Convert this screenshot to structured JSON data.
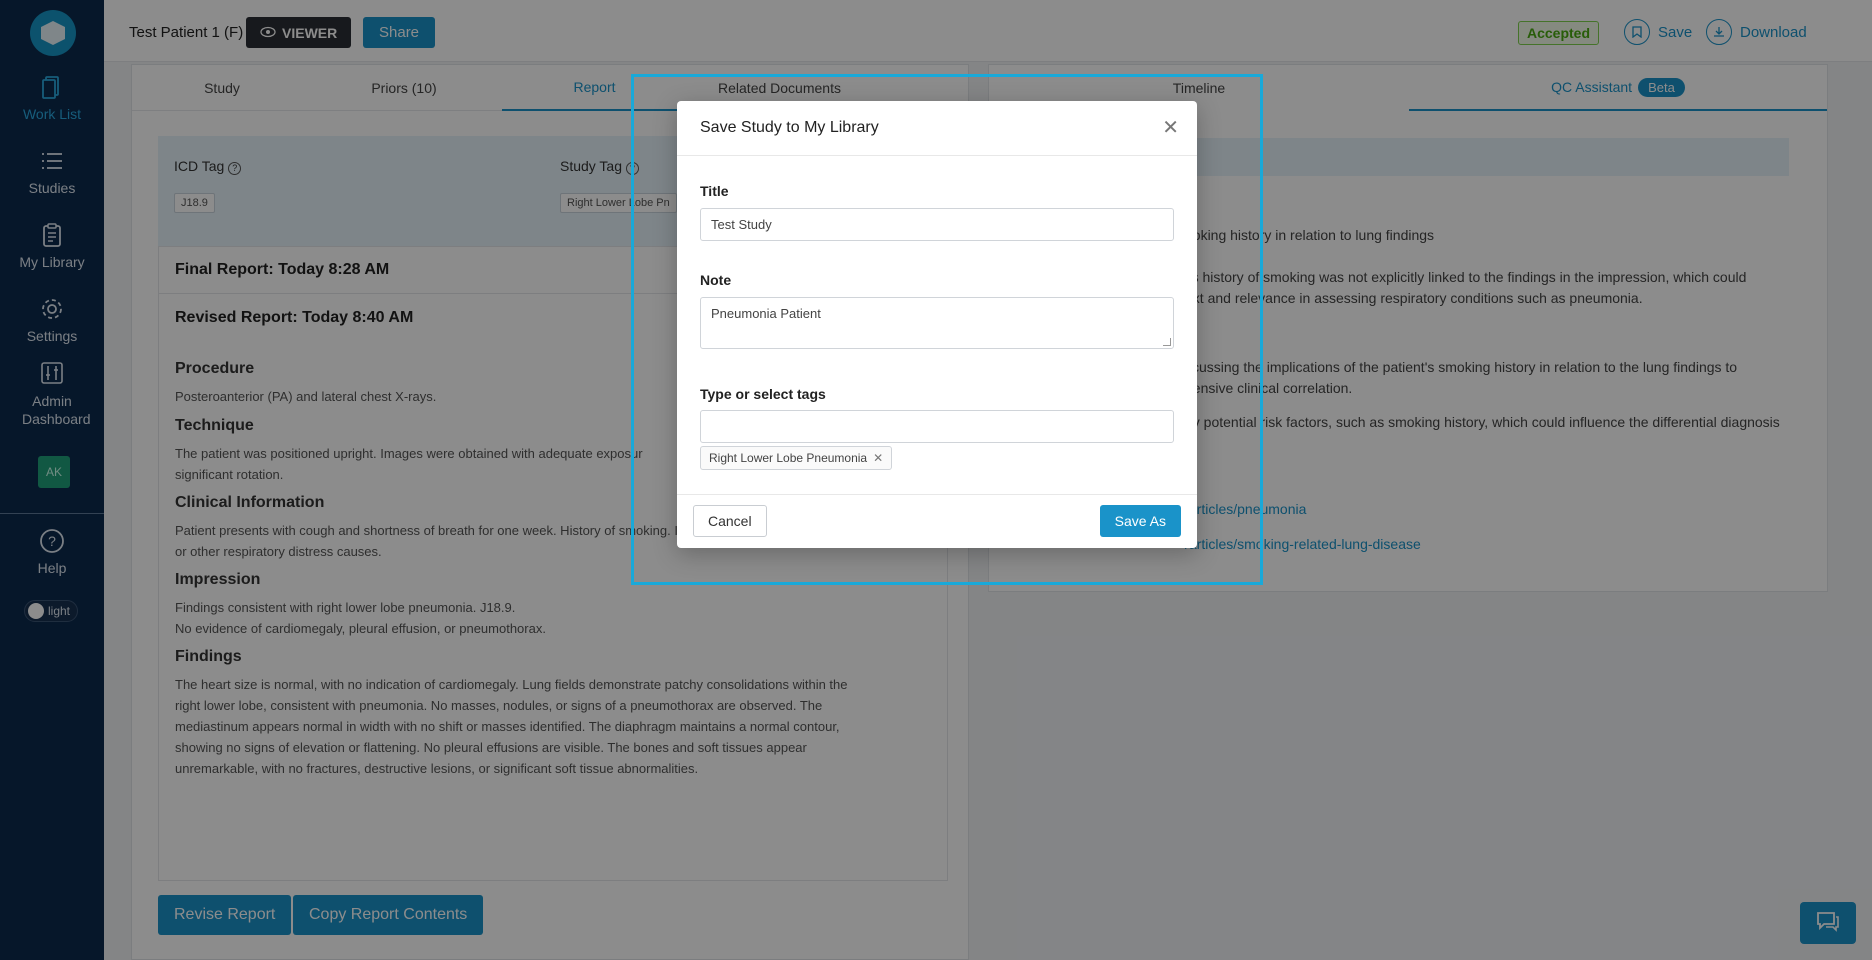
{
  "sidebar": {
    "items": [
      {
        "label": "Work List",
        "icon": "worklist-icon"
      },
      {
        "label": "Studies",
        "icon": "list-icon"
      },
      {
        "label": "My Library",
        "icon": "clipboard-icon"
      },
      {
        "label": "Settings",
        "icon": "gear-icon"
      },
      {
        "label": "Admin Dashboard",
        "icon": "sliders-icon"
      }
    ],
    "avatar": "AK",
    "help": "Help",
    "theme_toggle": "light"
  },
  "header": {
    "patient": "Test Patient 1 (F)",
    "viewer_label": "VIEWER",
    "share_label": "Share",
    "status": "Accepted",
    "save_label": "Save",
    "download_label": "Download"
  },
  "left": {
    "tabs": [
      "Study",
      "Priors (10)",
      "Report",
      "Related Documents"
    ],
    "icd_tag_label": "ICD Tag",
    "icd_tag_value": "J18.9",
    "study_tag_label": "Study Tag",
    "study_tag_value": "Right Lower Lobe Pn",
    "final_report": "Final Report: Today 8:28 AM",
    "revised_report": "Revised Report: Today 8:40 AM",
    "sections": [
      {
        "title": "Procedure",
        "text": "Posteroanterior (PA) and lateral chest X-rays."
      },
      {
        "title": "Technique",
        "text": "The patient was positioned upright. Images were obtained with adequate exposur\nsignificant rotation."
      },
      {
        "title": "Clinical Information",
        "text": "Patient presents with cough and shortness of breath for one week. History of smoking. Indication: Evaluate for pneumonia\nor other respiratory distress causes."
      },
      {
        "title": "Impression",
        "text": "Findings consistent with right lower lobe pneumonia. J18.9.\nNo evidence of cardiomegaly, pleural effusion, or pneumothorax."
      },
      {
        "title": "Findings",
        "text": "The heart size is normal, with no indication of cardiomegaly. Lung fields demonstrate patchy consolidations within the\nright lower lobe, consistent with pneumonia. No masses, nodules, or signs of a pneumothorax are observed. The\nmediastinum appears normal in width with no shift or masses identified. The diaphragm maintains a normal contour,\nshowing no signs of elevation or flattening. No pleural effusions are visible. The bones and soft tissues appear\nunremarkable, with no fractures, destructive lesions, or significant soft tissue abnormalities."
      }
    ],
    "revise_button": "Revise Report",
    "copy_button": "Copy Report Contents"
  },
  "right": {
    "tabs": [
      "Timeline",
      "QC Assistant"
    ],
    "beta": "Beta",
    "lines": [
      "noking history in relation to lung findings",
      "t's history of smoking was not explicitly linked to the findings in the impression, which could",
      "ext and relevance in assessing respiratory conditions such as pneumonia.",
      "scussing the implications of the patient's smoking history in relation to the lung findings to",
      "hensive clinical correlation.",
      "ny potential risk factors, such as smoking history, which could influence the differential diagnosis"
    ],
    "links": [
      "/articles/pneumonia",
      "/articles/smoking-related-lung-disease"
    ]
  },
  "modal": {
    "title": "Save Study to My Library",
    "title_label": "Title",
    "title_value": "Test Study",
    "note_label": "Note",
    "note_value": "Pneumonia Patient",
    "tags_label": "Type or select tags",
    "tags_placeholder": "",
    "selected_tag": "Right Lower Lobe Pneumonia",
    "cancel_label": "Cancel",
    "save_as_label": "Save As"
  },
  "colors": {
    "accent": "#1a93c9",
    "sidebar_bg": "#0c2a4e",
    "accepted": "#49a912",
    "highlight": "#19a9d9"
  }
}
